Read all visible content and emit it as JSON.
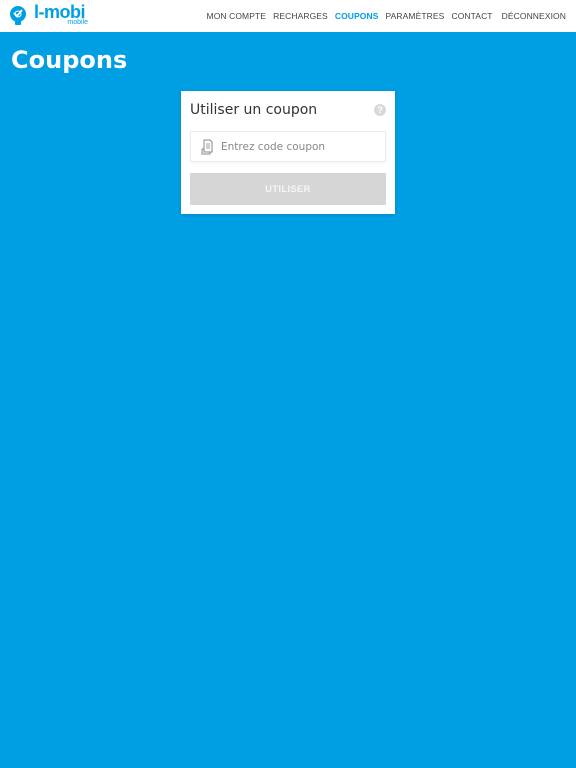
{
  "brand": {
    "name": "l-mobi",
    "tagline": "mobile",
    "color": "#009fe3"
  },
  "nav": {
    "items": [
      {
        "label": "MON COMPTE"
      },
      {
        "label": "RECHARGES"
      },
      {
        "label": "COUPONS",
        "active": true
      },
      {
        "label": "PARAMÈTRES"
      },
      {
        "label": "CONTACT"
      },
      {
        "label": "DÉCONNEXION"
      }
    ]
  },
  "page": {
    "title": "Coupons",
    "background": "#009fe3"
  },
  "card": {
    "title": "Utiliser un coupon",
    "help_icon": "question-icon",
    "input": {
      "icon": "receipt-icon",
      "placeholder": "Entrez code coupon",
      "value": ""
    },
    "button_label": "UTILISER"
  }
}
